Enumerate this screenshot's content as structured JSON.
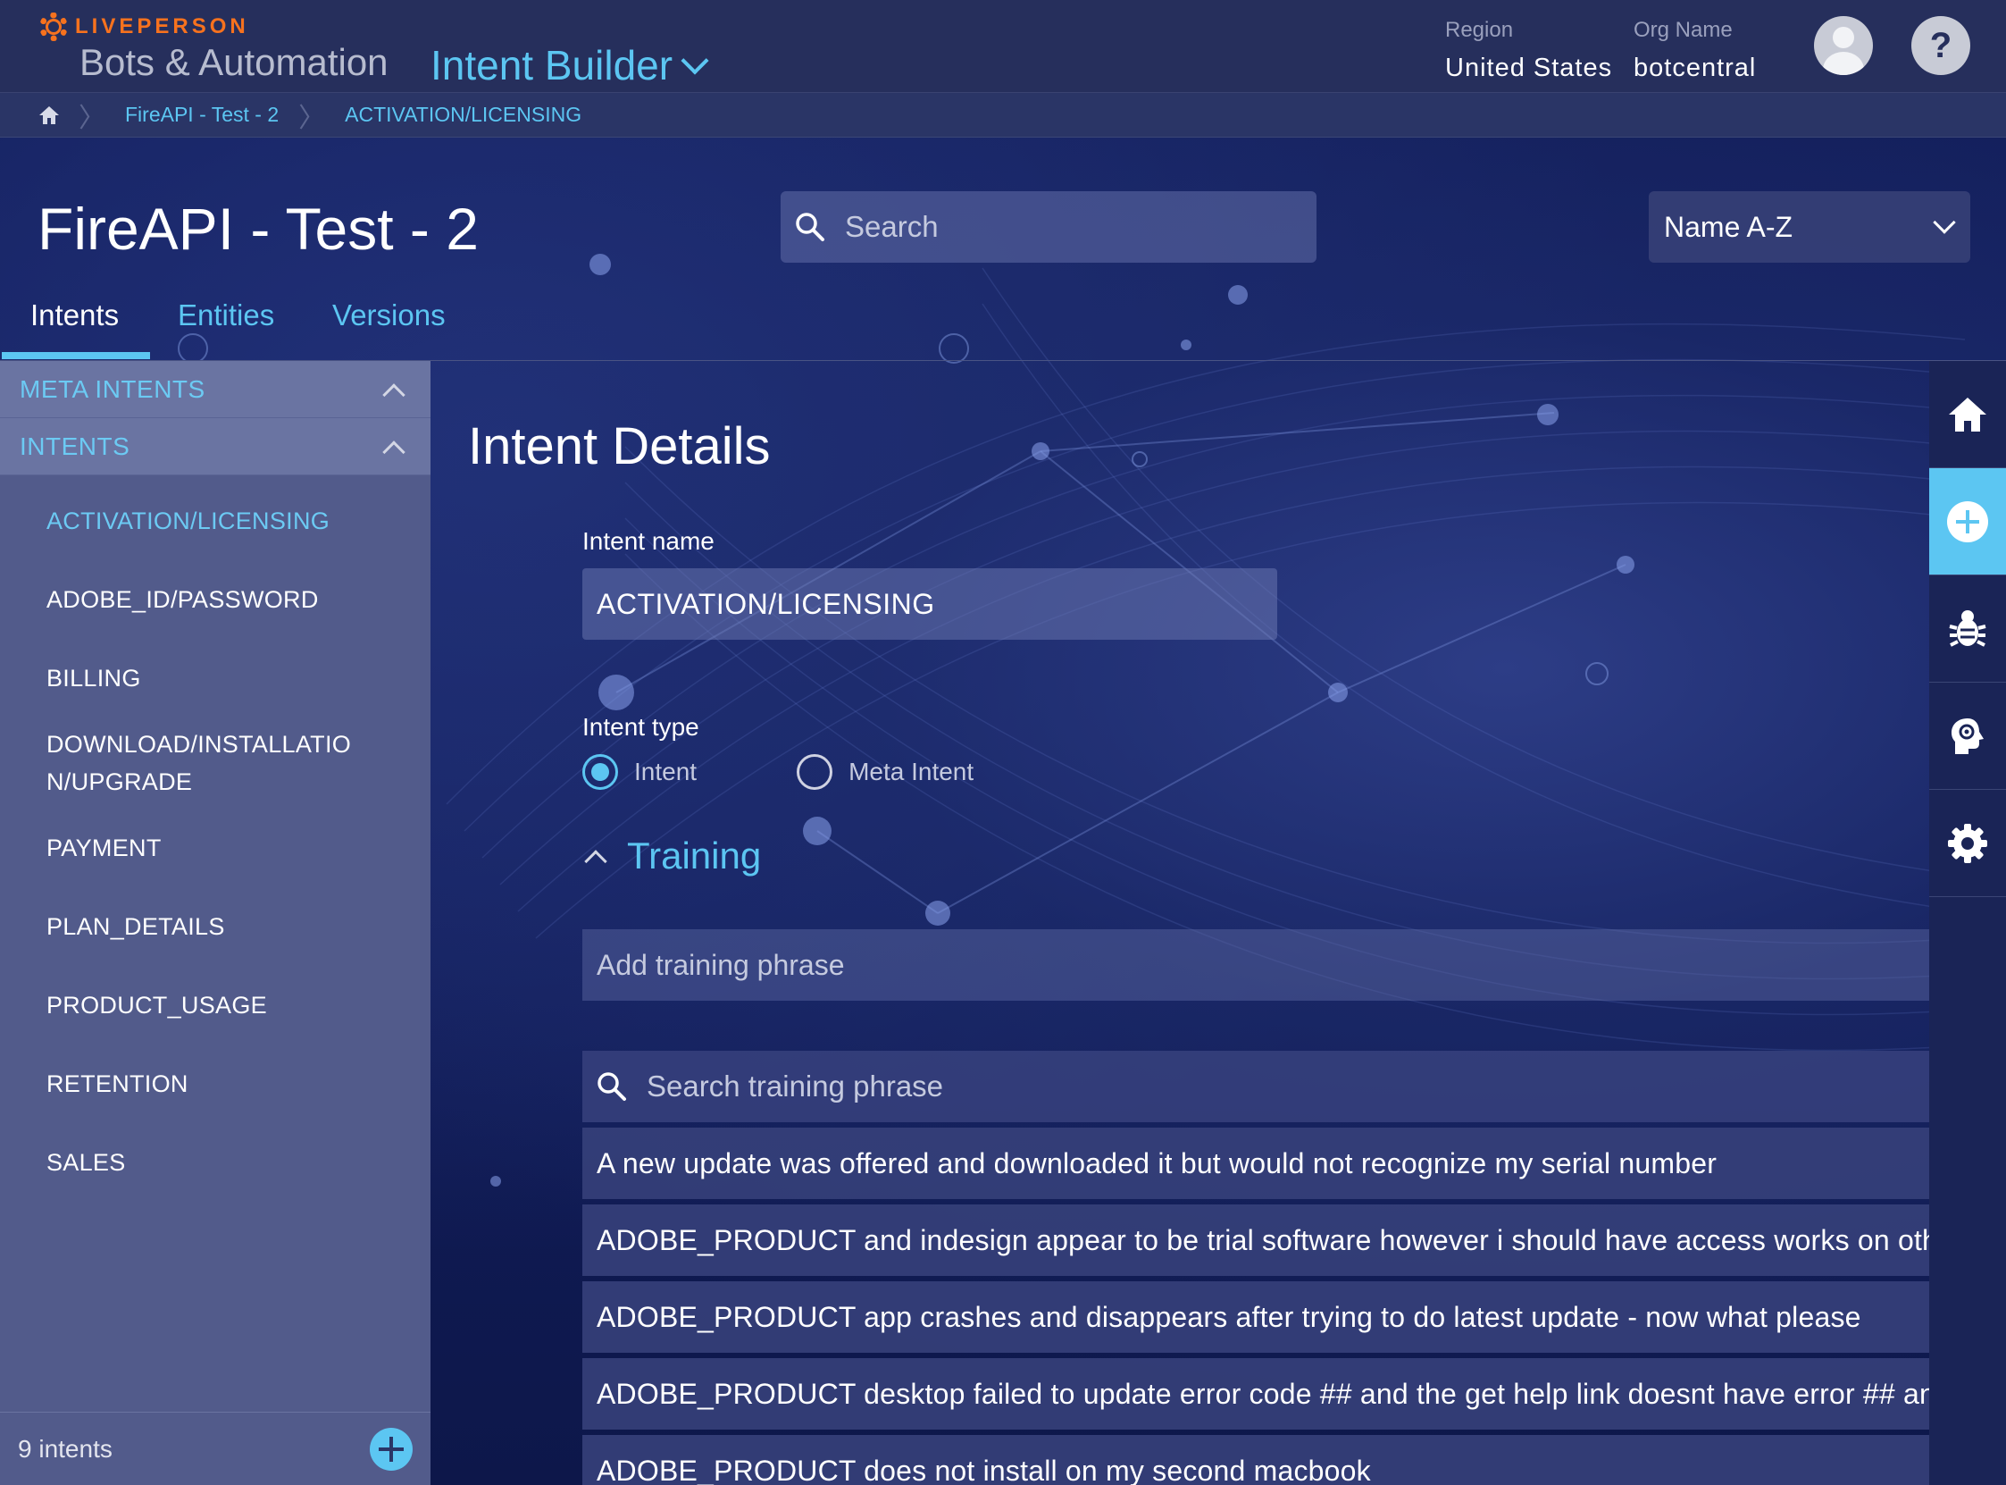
{
  "header": {
    "brand": "LIVEPERSON",
    "app_name": "Bots & Automation",
    "product_name": "Intent Builder",
    "region_label": "Region",
    "region_value": "United States",
    "org_label": "Org Name",
    "org_value": "botcentral",
    "help_glyph": "?"
  },
  "breadcrumb": {
    "items": [
      "FireAPI - Test - 2",
      "ACTIVATION/LICENSING"
    ]
  },
  "page": {
    "title": "FireAPI - Test - 2",
    "search_placeholder": "Search",
    "sort_value": "Name A-Z",
    "tabs": [
      "Intents",
      "Entities",
      "Versions"
    ],
    "active_tab": "Intents"
  },
  "sidebar": {
    "groups": [
      "META INTENTS",
      "INTENTS"
    ],
    "items": [
      "ACTIVATION/LICENSING",
      "ADOBE_ID/PASSWORD",
      "BILLING",
      "DOWNLOAD/INSTALLATIO N/UPGRADE",
      "PAYMENT",
      "PLAN_DETAILS",
      "PRODUCT_USAGE",
      "RETENTION",
      "SALES"
    ],
    "active_item": "ACTIVATION/LICENSING",
    "count_label": "9 intents"
  },
  "detail": {
    "title": "Intent Details",
    "name_label": "Intent name",
    "name_value": "ACTIVATION/LICENSING",
    "type_label": "Intent type",
    "type_options": [
      "Intent",
      "Meta Intent"
    ],
    "type_selected": "Intent",
    "training_label": "Training",
    "add_phrase_placeholder": "Add training phrase",
    "search_phrase_placeholder": "Search training phrase",
    "phrases": [
      "A new update was offered and downloaded it but would not recognize my serial number",
      "ADOBE_PRODUCT and indesign appear to be trial software however i should have access works on othe",
      "ADOBE_PRODUCT app crashes and disappears after trying to do latest update - now what please",
      "ADOBE_PRODUCT desktop failed to update error code ## and the get help link doesnt have error ## any",
      "ADOBE_PRODUCT does not install on my second macbook"
    ]
  },
  "rail": {
    "icons": [
      "home-icon",
      "add-icon",
      "bug-icon",
      "brain-icon",
      "gear-icon"
    ],
    "active": "add-icon"
  },
  "colors": {
    "accent": "#5cc6f2",
    "brand_orange": "#f7721e",
    "header_bg": "#262f5c",
    "sidebar_bg": "#525b8b"
  }
}
